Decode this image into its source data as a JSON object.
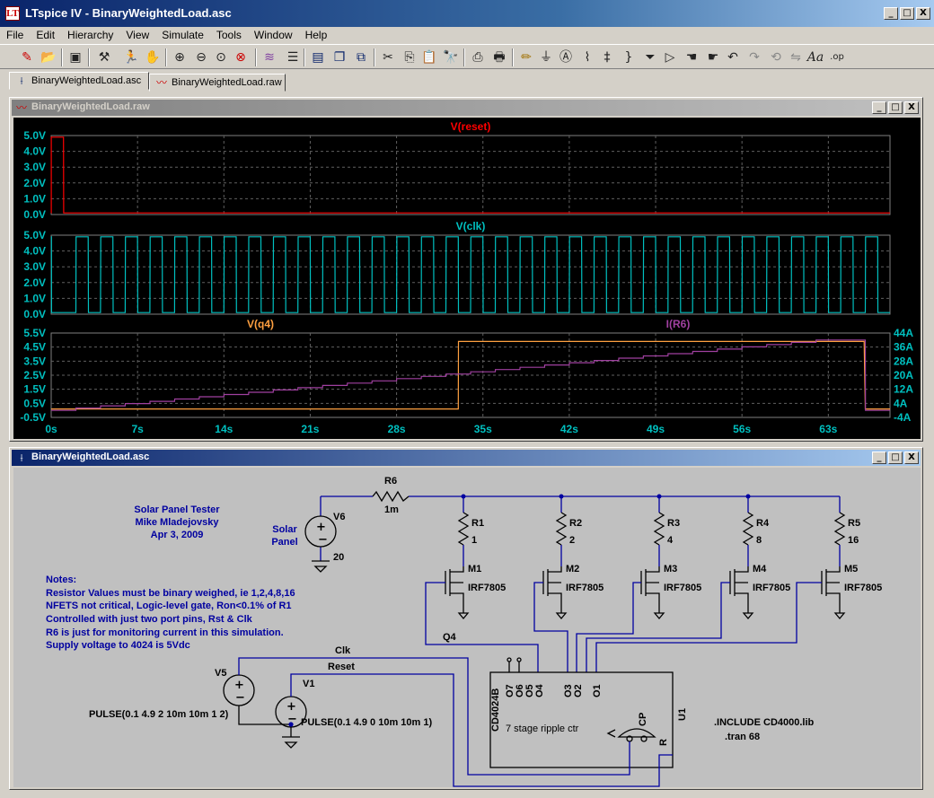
{
  "window": {
    "title": "LTspice IV - BinaryWeightedLoad.asc",
    "icon": "ltspice-logo-icon",
    "controls": [
      "_",
      "□",
      "X"
    ]
  },
  "menu": [
    "File",
    "Edit",
    "Hierarchy",
    "View",
    "Simulate",
    "Tools",
    "Window",
    "Help"
  ],
  "toolbar_icons": [
    "new-schematic-icon",
    "open-icon",
    "save-icon",
    "control-panel-icon",
    "run-icon",
    "halt-icon",
    "zoom-in-icon",
    "zoom-out-icon",
    "zoom-fit-icon",
    "zoom-cancel-icon",
    "autoscale-icon",
    "tile-horizontal-icon",
    "cascade-icon",
    "close-window-icon",
    "cut-icon",
    "copy-icon",
    "paste-icon",
    "find-icon",
    "print-preview-icon",
    "print-icon",
    "wire-icon",
    "ground-icon",
    "label-icon",
    "resistor-icon",
    "capacitor-icon",
    "inductor-icon",
    "diode-icon",
    "component-icon",
    "move-icon",
    "drag-icon",
    "undo-icon",
    "redo-icon",
    "rotate-icon",
    "mirror-icon",
    "text-icon",
    "spice-directive-icon"
  ],
  "tabs": [
    {
      "label": "BinaryWeightedLoad.asc",
      "icon": "schematic-icon"
    },
    {
      "label": "BinaryWeightedLoad.raw",
      "icon": "waveform-icon"
    }
  ],
  "plot_window": {
    "title": "BinaryWeightedLoad.raw"
  },
  "schematic_window": {
    "title": "BinaryWeightedLoad.asc"
  },
  "chart_data": [
    {
      "type": "line",
      "title": "V(reset)",
      "xlim": [
        0,
        68
      ],
      "ylim": [
        0,
        5
      ],
      "yticks": [
        "5.0V",
        "4.0V",
        "3.0V",
        "2.0V",
        "1.0V",
        "0.0V"
      ],
      "series": [
        {
          "name": "V(reset)",
          "color": "#ff0000",
          "x": [
            0,
            0.01,
            0.01,
            1,
            1.01,
            68
          ],
          "y": [
            0.1,
            0.1,
            4.9,
            4.9,
            0.1,
            0.1
          ]
        }
      ]
    },
    {
      "type": "line",
      "title": "V(clk)",
      "xlim": [
        0,
        68
      ],
      "ylim": [
        0,
        5
      ],
      "yticks": [
        "5.0V",
        "4.0V",
        "3.0V",
        "2.0V",
        "1.0V",
        "0.0V"
      ],
      "series": [
        {
          "name": "V(clk)",
          "color": "#00c0c0",
          "pulse": {
            "v1": 0.1,
            "v2": 4.9,
            "delay": 2,
            "on": 1,
            "period": 2
          }
        }
      ]
    },
    {
      "type": "line",
      "xlim": [
        0,
        68
      ],
      "ylim": [
        -0.5,
        5.5
      ],
      "yticks": [
        "5.5V",
        "4.5V",
        "3.5V",
        "2.5V",
        "1.5V",
        "0.5V",
        "-0.5V"
      ],
      "y2lim": [
        -4,
        44
      ],
      "y2ticks": [
        "44A",
        "36A",
        "28A",
        "20A",
        "12A",
        "4A",
        "-4A"
      ],
      "xticks": [
        "0s",
        "7s",
        "14s",
        "21s",
        "28s",
        "35s",
        "42s",
        "49s",
        "56s",
        "63s"
      ],
      "series": [
        {
          "name": "V(q4)",
          "color": "#ffa040",
          "x": [
            0,
            33,
            33.02,
            65.9,
            66,
            68
          ],
          "y": [
            0.1,
            0.1,
            4.9,
            4.9,
            0.1,
            0.1
          ]
        },
        {
          "name": "I(R6)",
          "color": "#a040a0",
          "axis": "right",
          "steps_start": 2,
          "steps_end": 66,
          "step": 2,
          "max_A": 40,
          "x_end": 68
        }
      ]
    }
  ],
  "schematic": {
    "notes_title": [
      "Solar Panel Tester",
      "Mike Mladejovsky",
      "Apr 3, 2009"
    ],
    "notes": [
      "Notes:",
      "Resistor Values must be binary weighed, ie 1,2,4,8,16",
      "NFETS not critical, Logic-level gate, Ron<0.1% of R1",
      "Controlled with just two port pins, Rst & Clk",
      "R6 is just for monitoring current in this simulation.",
      "Supply voltage to 4024 is 5Vdc"
    ],
    "solar_label": [
      "Solar",
      "Panel"
    ],
    "v6": {
      "name": "V6",
      "value": "20"
    },
    "r6": {
      "name": "R6",
      "value": "1m"
    },
    "resistors": [
      {
        "name": "R1",
        "value": "1"
      },
      {
        "name": "R2",
        "value": "2"
      },
      {
        "name": "R3",
        "value": "4"
      },
      {
        "name": "R4",
        "value": "8"
      },
      {
        "name": "R5",
        "value": "16"
      }
    ],
    "mosfets": [
      {
        "name": "M1",
        "value": "IRF7805"
      },
      {
        "name": "M2",
        "value": "IRF7805"
      },
      {
        "name": "M3",
        "value": "IRF7805"
      },
      {
        "name": "M4",
        "value": "IRF7805"
      },
      {
        "name": "M5",
        "value": "IRF7805"
      }
    ],
    "net_q4": "Q4",
    "net_clk": "Clk",
    "net_reset": "Reset",
    "v5": {
      "name": "V5",
      "value": "PULSE(0.1 4.9 2 10m 10m 1 2)"
    },
    "v1": {
      "name": "V1",
      "value": "PULSE(0.1 4.9 0 10m 10m 1)"
    },
    "u1": {
      "name": "U1",
      "part": "CD4024B",
      "desc": "7 stage ripple ctr",
      "pins": [
        "O7",
        "O6",
        "O5",
        "O4",
        "O3",
        "O2",
        "O1"
      ],
      "cp": "CP",
      "r": "R"
    },
    "directives": [
      ".INCLUDE CD4000.lib",
      ".tran 68"
    ]
  }
}
